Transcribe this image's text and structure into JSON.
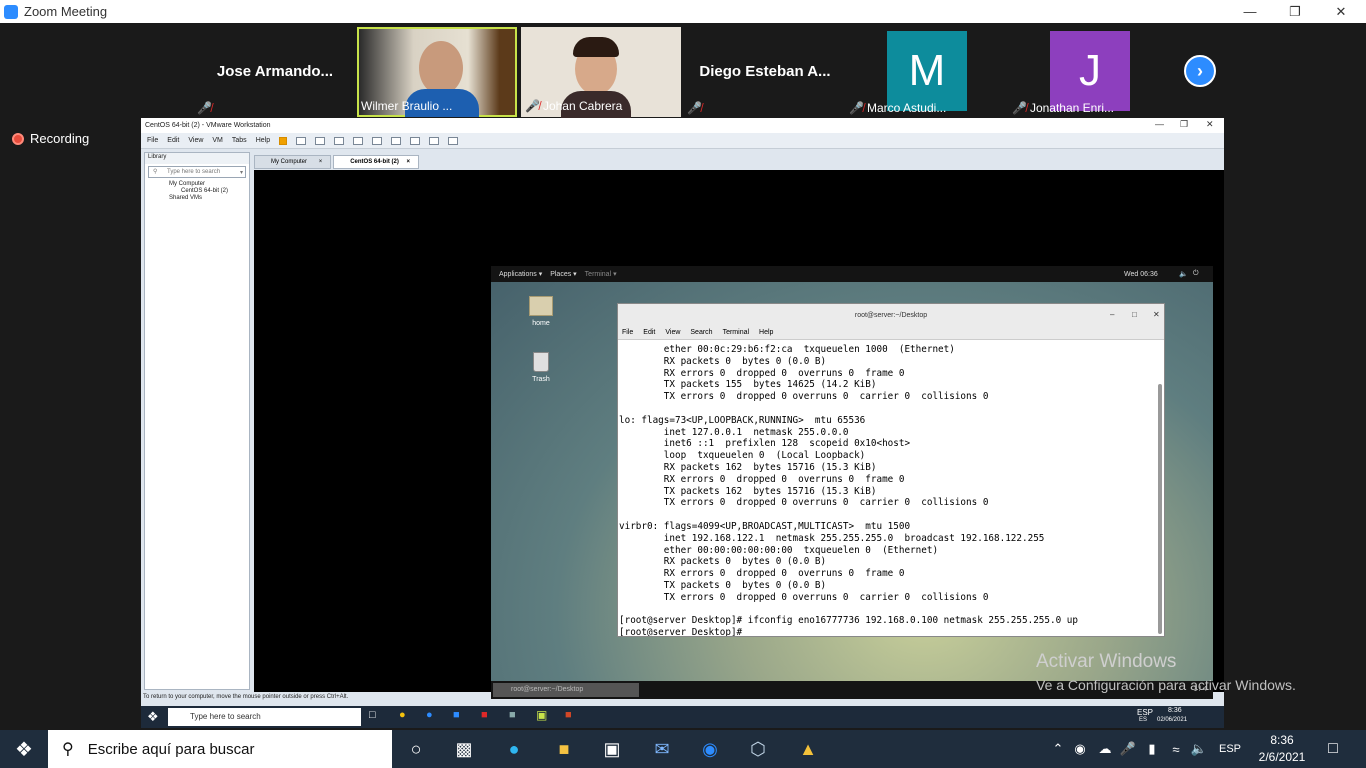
{
  "zoom": {
    "title": "Zoom Meeting",
    "recording_label": "Recording",
    "participants": [
      {
        "name": "Jose Armando...",
        "label": "",
        "kind": "name-only"
      },
      {
        "name": "",
        "label": "Wilmer Braulio ...",
        "kind": "video",
        "active": true
      },
      {
        "name": "",
        "label": "Johan Cabrera",
        "kind": "video"
      },
      {
        "name": "Diego Esteban A...",
        "label": "",
        "kind": "name-only"
      },
      {
        "name": "",
        "label": "Marco Astudi...",
        "kind": "avatar",
        "initial": "M",
        "color": "#0d8c9c"
      },
      {
        "name": "",
        "label": "Jonathan Enri...",
        "kind": "avatar",
        "initial": "J",
        "color": "#8d3fbe"
      }
    ],
    "next_label": "›"
  },
  "vmware": {
    "title": "CentOS 64-bit (2) - VMware Workstation",
    "menu": [
      "File",
      "Edit",
      "View",
      "VM",
      "Tabs",
      "Help"
    ],
    "library": {
      "header": "Library",
      "search_placeholder": "Type here to search",
      "tree": [
        "My Computer",
        "CentOS 64-bit (2)",
        "Shared VMs"
      ]
    },
    "tabs": [
      "My Computer",
      "CentOS 64-bit (2)"
    ],
    "status_text": "To return to your computer, move the mouse pointer outside or press Ctrl+Alt."
  },
  "guest": {
    "topbar": {
      "applications": "Applications ▾",
      "places": "Places ▾",
      "terminal": "Terminal ▾",
      "clock": "Wed 06:36"
    },
    "icons": [
      "home",
      "Trash"
    ],
    "terminal": {
      "title": "root@server:~/Desktop",
      "menu": [
        "File",
        "Edit",
        "View",
        "Search",
        "Terminal",
        "Help"
      ],
      "lines": [
        "        ether 00:0c:29:b6:f2:ca  txqueuelen 1000  (Ethernet)",
        "        RX packets 0  bytes 0 (0.0 B)",
        "        RX errors 0  dropped 0  overruns 0  frame 0",
        "        TX packets 155  bytes 14625 (14.2 KiB)",
        "        TX errors 0  dropped 0 overruns 0  carrier 0  collisions 0",
        "",
        "lo: flags=73<UP,LOOPBACK,RUNNING>  mtu 65536",
        "        inet 127.0.0.1  netmask 255.0.0.0",
        "        inet6 ::1  prefixlen 128  scopeid 0x10<host>",
        "        loop  txqueuelen 0  (Local Loopback)",
        "        RX packets 162  bytes 15716 (15.3 KiB)",
        "        RX errors 0  dropped 0  overruns 0  frame 0",
        "        TX packets 162  bytes 15716 (15.3 KiB)",
        "        TX errors 0  dropped 0 overruns 0  carrier 0  collisions 0",
        "",
        "virbr0: flags=4099<UP,BROADCAST,MULTICAST>  mtu 1500",
        "        inet 192.168.122.1  netmask 255.255.255.0  broadcast 192.168.122.255",
        "        ether 00:00:00:00:00:00  txqueuelen 0  (Ethernet)",
        "        RX packets 0  bytes 0 (0.0 B)",
        "        RX errors 0  dropped 0  overruns 0  frame 0",
        "        TX packets 0  bytes 0 (0.0 B)",
        "        TX errors 0  dropped 0 overruns 0  carrier 0  collisions 0",
        "",
        "[root@server Desktop]# ifconfig eno16777736 192.168.0.100 netmask 255.255.255.0 up",
        "[root@server Desktop]# "
      ]
    },
    "bottom_task": "root@server:~/Desktop",
    "pager": "1 / 4"
  },
  "watermark": {
    "line1": "Activar Windows",
    "line2": "Ve a Configuración para activar Windows."
  },
  "inner_taskbar": {
    "search_placeholder": "Type here to search",
    "lang": "ESP",
    "lang2": "ES",
    "time": "8:36",
    "date": "02/06/2021"
  },
  "taskbar": {
    "search_placeholder": "Escribe aquí para buscar",
    "lang": "ESP",
    "time": "8:36",
    "date": "2/6/2021"
  },
  "colors": {
    "zoom_blue": "#2d8cff",
    "active_speaker": "#c8e34a",
    "muted_red": "#e02828"
  }
}
